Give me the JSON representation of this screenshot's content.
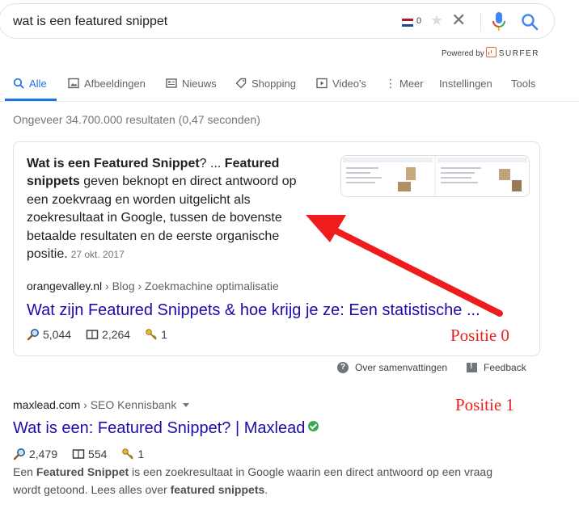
{
  "search": {
    "query": "wat is een featured snippet",
    "flag_count": "0"
  },
  "powered_by": {
    "label": "Powered by",
    "brand": "SURFER"
  },
  "tabs": [
    {
      "label": "Alle",
      "icon": "search-icon",
      "active": true
    },
    {
      "label": "Afbeeldingen",
      "icon": "image-icon"
    },
    {
      "label": "Nieuws",
      "icon": "news-icon"
    },
    {
      "label": "Shopping",
      "icon": "tag-icon"
    },
    {
      "label": "Video's",
      "icon": "play-icon"
    },
    {
      "label": "Meer",
      "icon": "more-vert-icon"
    },
    {
      "label": "Instellingen"
    },
    {
      "label": "Tools"
    }
  ],
  "stats": "Ongeveer 34.700.000 resultaten (0,47 seconden)",
  "featured": {
    "snippet_parts": [
      {
        "text": "Wat is een Featured Snippet",
        "bold": true
      },
      {
        "text": "? ... ",
        "bold": false
      },
      {
        "text": "Featured snippets",
        "bold": true
      },
      {
        "text": " geven beknopt en direct antwoord op een zoekvraag en worden uitgelicht als zoekresultaat in Google, tussen de bovenste betaalde resultaten en de eerste organische positie.",
        "bold": false
      }
    ],
    "date": "27 okt. 2017",
    "breadcrumb_site": "orangevalley.nl",
    "breadcrumb_path": "› Blog › Zoekmachine optimalisatie",
    "title": "Wat zijn Featured Snippets & hoe krijg je ze: Een statistische ...",
    "metrics": {
      "searches": "5,044",
      "pages": "2,264",
      "keywords": "1"
    }
  },
  "footer_links": {
    "about": "Over samenvattingen",
    "feedback": "Feedback"
  },
  "result2": {
    "site": "maxlead.com",
    "path": "› SEO Kennisbank",
    "title": "Wat is een: Featured Snippet? | Maxlead",
    "metrics": {
      "searches": "2,479",
      "pages": "554",
      "keywords": "1"
    },
    "desc_parts": [
      {
        "text": "Een ",
        "bold": false
      },
      {
        "text": "Featured Snippet",
        "bold": true
      },
      {
        "text": " is een zoekresultaat in Google waarin een direct antwoord op een vraag wordt getoond. Lees alles over ",
        "bold": false
      },
      {
        "text": "featured snippets",
        "bold": true
      },
      {
        "text": ".",
        "bold": false
      }
    ]
  },
  "annotations": {
    "pos0": "Positie 0",
    "pos1": "Positie 1",
    "color": "#e8231f"
  },
  "colors": {
    "link": "#1a0dab",
    "accent": "#1a73e8"
  }
}
